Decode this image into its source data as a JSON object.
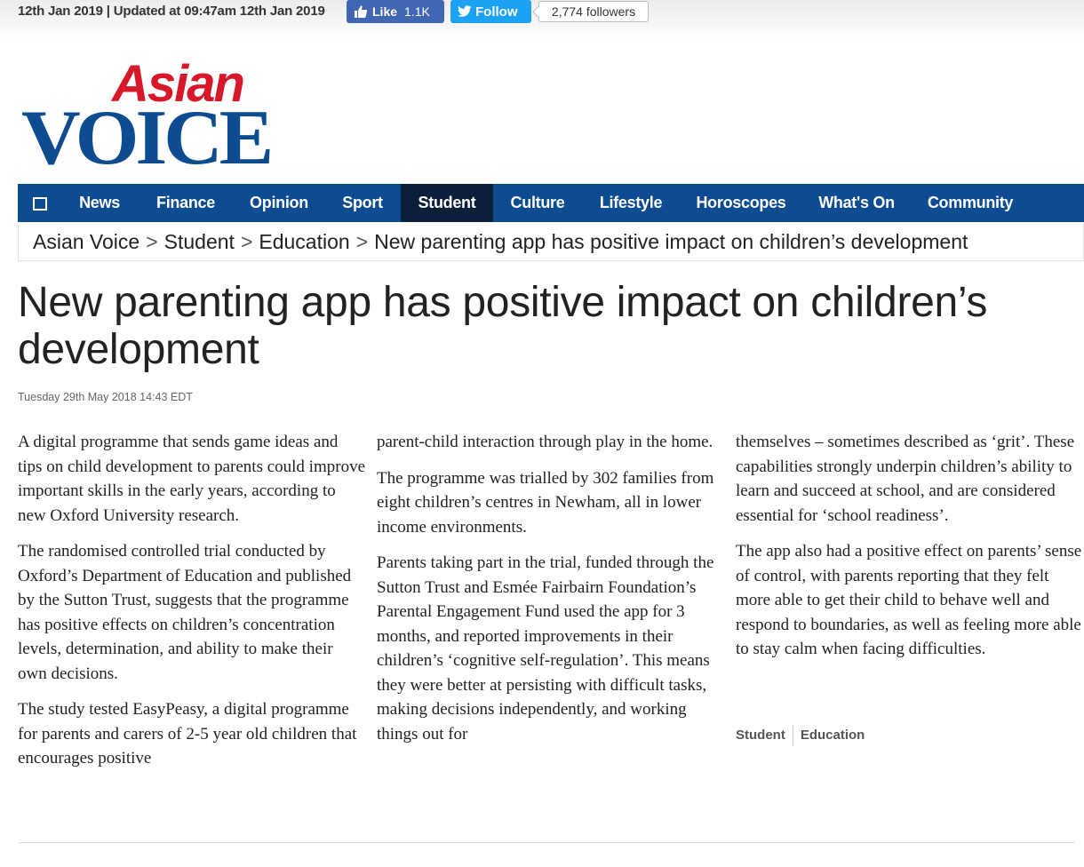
{
  "topbar": {
    "date_text": "12th Jan 2019 | Updated at 09:47am 12th Jan 2019",
    "like_label": "Like",
    "like_count": "1.1K",
    "follow_label": "Follow",
    "followers_text": "2,774 followers"
  },
  "logo": {
    "line1": "Asian",
    "line2": "VOICE"
  },
  "nav": {
    "items": [
      "News",
      "Finance",
      "Opinion",
      "Sport",
      "Student",
      "Culture",
      "Lifestyle",
      "Horoscopes",
      "What's On",
      "Community"
    ],
    "active": "Student"
  },
  "breadcrumb": {
    "items": [
      "Asian Voice",
      "Student",
      "Education",
      "New parenting app has positive impact on children’s development"
    ],
    "separator": ">"
  },
  "article": {
    "headline_line1": "New parenting app has positive impact on children’s",
    "headline_line2": "development",
    "dateline": "Tuesday 29th May 2018 14:43 EDT",
    "col1": [
      "A digital programme that sends game ideas and tips on child development to parents could improve important skills in the early years, according to new Oxford University research.",
      "The randomised controlled trial conducted by Oxford’s Department of Education and published by the Sutton Trust, suggests that the programme has positive effects on children’s concentration levels, determination, and ability to make their own decisions.",
      "The study tested EasyPeasy, a digital programme for parents and carers of 2-5 year old children that encourages positive"
    ],
    "col2": [
      "parent-child interaction through play in the home.",
      "The programme was trialled by 302 families from eight children’s centres in Newham, all in lower income environments.",
      "Parents taking part in the trial, funded through the Sutton Trust and Esmée Fairbairn Foundation’s Parental Engagement Fund used the app for 3 months, and reported improvements in their children’s ‘cognitive self-regulation’. This means they were better at persisting with difficult tasks, making decisions independently, and working things out for"
    ],
    "col3": [
      "themselves – sometimes described as ‘grit’. These capabilities strongly underpin children’s ability to learn and succeed at school, and are considered essential for ‘school readiness’.",
      "The app also had a positive effect on parents’ sense of control, with parents reporting that they felt more able to get their child to behave well and respond to boundaries, as well as feeling more able to stay calm when facing difficulties."
    ],
    "tags": [
      "Student",
      "Education"
    ]
  },
  "colors": {
    "nav_bg": "#0e4c92",
    "nav_active_bg": "#0b1f3b",
    "logo_red": "#d7182a",
    "logo_blue": "#0e4c92",
    "facebook": "#4267b2",
    "twitter": "#1da1f2"
  }
}
